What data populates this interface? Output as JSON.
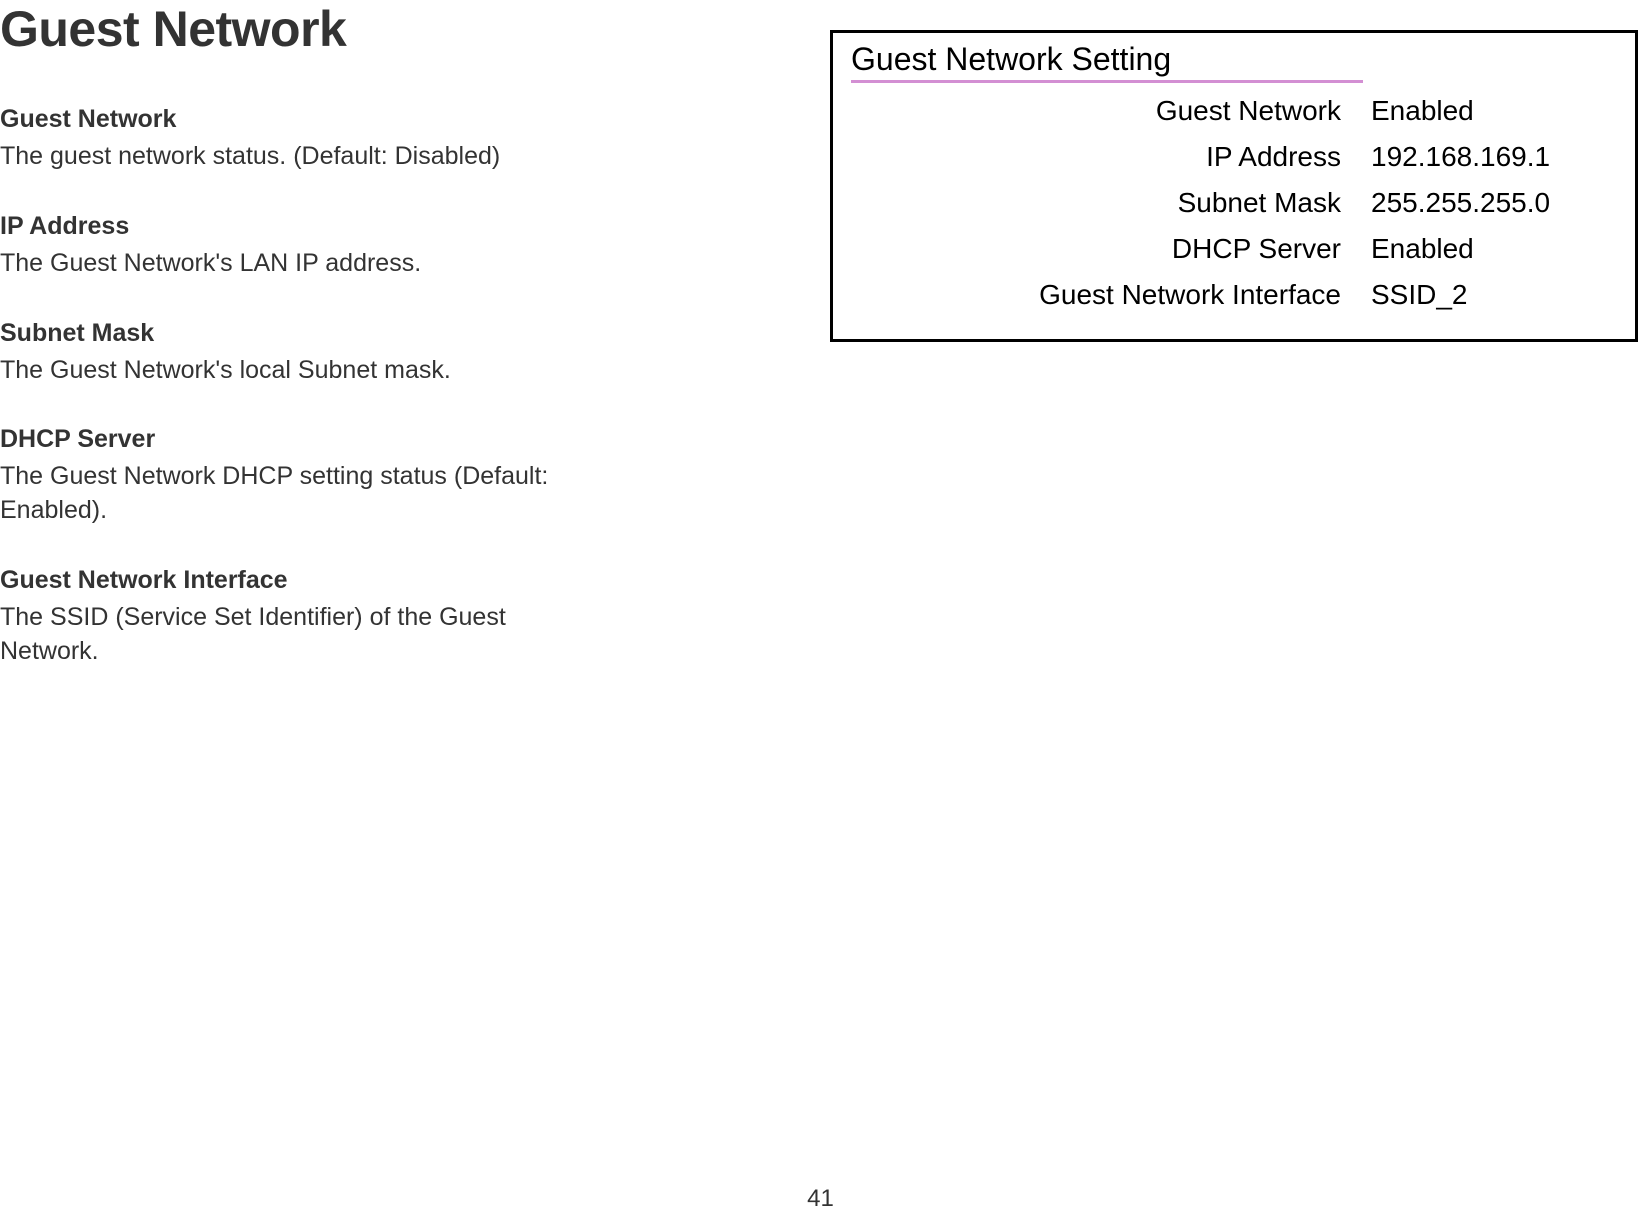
{
  "page": {
    "title": "Guest Network",
    "number": "41"
  },
  "definitions": [
    {
      "label": "Guest Network",
      "desc": "The guest network status. (Default: Disabled)"
    },
    {
      "label": "IP Address",
      "desc": "The Guest Network's LAN IP address."
    },
    {
      "label": "Subnet Mask",
      "desc": "The Guest Network's local Subnet mask."
    },
    {
      "label": "DHCP Server",
      "desc": "The Guest Network DHCP setting status (Default: Enabled)."
    },
    {
      "label": "Guest Network Interface",
      "desc": "The SSID (Service Set Identifier) of the Guest Network."
    }
  ],
  "panel": {
    "title": "Guest Network Setting",
    "rows": [
      {
        "label": "Guest Network",
        "value": "Enabled"
      },
      {
        "label": "IP Address",
        "value": "192.168.169.1"
      },
      {
        "label": "Subnet Mask",
        "value": "255.255.255.0"
      },
      {
        "label": "DHCP Server",
        "value": "Enabled"
      },
      {
        "label": "Guest Network Interface",
        "value": "SSID_2"
      }
    ]
  }
}
